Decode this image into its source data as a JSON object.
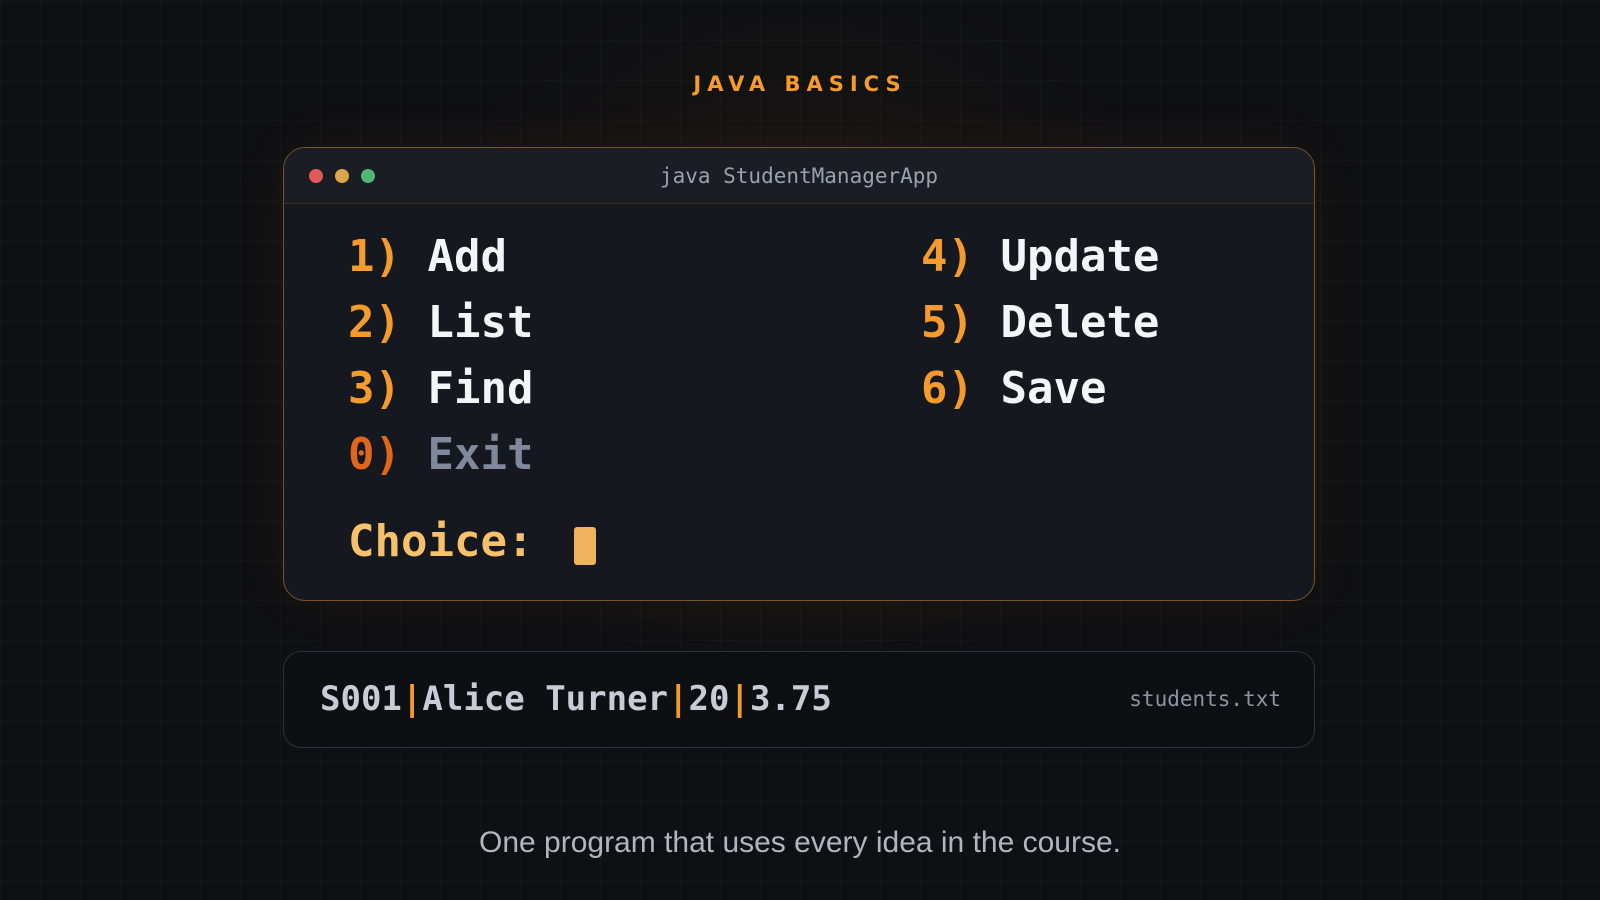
{
  "header": {
    "eyebrow": "JAVA BASICS"
  },
  "terminal": {
    "title": "java StudentManagerApp",
    "menu_left": [
      {
        "num": "1)",
        "label": "Add"
      },
      {
        "num": "2)",
        "label": "List"
      },
      {
        "num": "3)",
        "label": "Find"
      },
      {
        "num": "0)",
        "label": "Exit"
      }
    ],
    "menu_right": [
      {
        "num": "4)",
        "label": "Update"
      },
      {
        "num": "5)",
        "label": "Delete"
      },
      {
        "num": "6)",
        "label": "Save"
      }
    ],
    "prompt": "Choice:"
  },
  "record": {
    "fields": [
      "S001",
      "Alice Turner",
      "20",
      "3.75"
    ],
    "separator": "|",
    "filename": "students.txt"
  },
  "caption": "One program that uses every idea in the course.",
  "colors": {
    "accent": "#f59a2c",
    "exit_number": "#e0661a",
    "prompt": "#f7c06a",
    "background": "#0f1013",
    "window_close": "#e05a5a",
    "window_minimize": "#d9a64a",
    "window_maximize": "#4fb874"
  },
  "icons": [
    "window-close-dot-icon",
    "window-minimize-dot-icon",
    "window-maximize-dot-icon",
    "text-cursor-icon"
  ]
}
